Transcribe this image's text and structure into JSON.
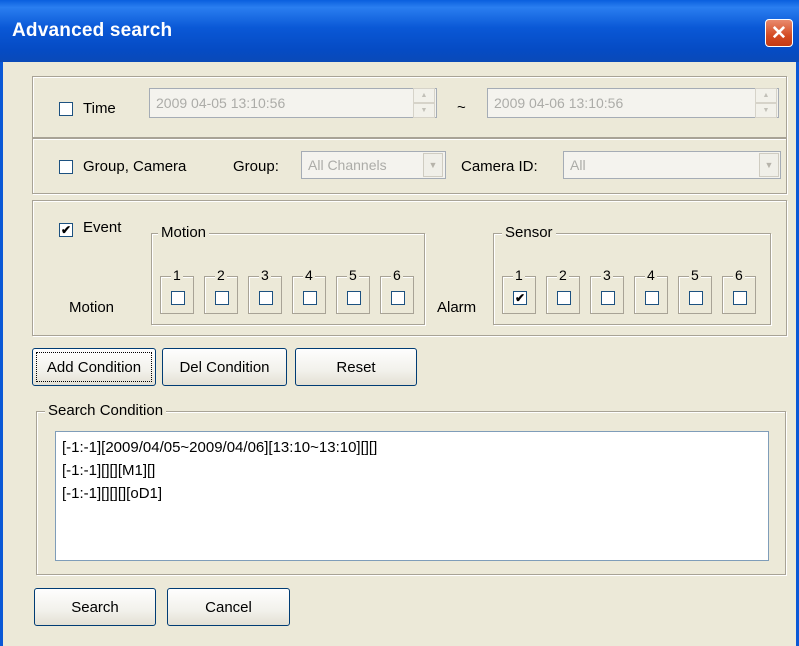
{
  "window": {
    "title": "Advanced search",
    "close_glyph": "✕"
  },
  "time": {
    "label": "Time",
    "checked": false,
    "from": "2009 04-05 13:10:56",
    "to": "2009 04-06 13:10:56",
    "separator": "~"
  },
  "group_camera": {
    "label": "Group, Camera",
    "checked": false,
    "group_label": "Group:",
    "group_value": "All Channels",
    "camera_label": "Camera ID:",
    "camera_value": "All"
  },
  "event": {
    "label": "Event",
    "checked": true,
    "motion_group": "Motion",
    "motion_label": "Motion",
    "sensor_group": "Sensor",
    "alarm_label": "Alarm",
    "motion_channels": [
      "1",
      "2",
      "3",
      "4",
      "5",
      "6"
    ],
    "sensor_channels": [
      "1",
      "2",
      "3",
      "4",
      "5",
      "6"
    ],
    "sensor_checked": [
      true,
      false,
      false,
      false,
      false,
      false
    ],
    "motion_checked": [
      false,
      false,
      false,
      false,
      false,
      false
    ]
  },
  "buttons": {
    "add": "Add Condition",
    "del": "Del Condition",
    "reset": "Reset",
    "search": "Search",
    "cancel": "Cancel"
  },
  "search_condition": {
    "label": "Search Condition",
    "items": [
      "[-1:-1][2009/04/05~2009/04/06][13:10~13:10][][]",
      "[-1:-1][][][M1][]",
      "[-1:-1][][][][oD1]"
    ]
  },
  "icons": {
    "spin_up": "▲",
    "spin_down": "▼",
    "dropdown": "▼",
    "check": "✔"
  }
}
